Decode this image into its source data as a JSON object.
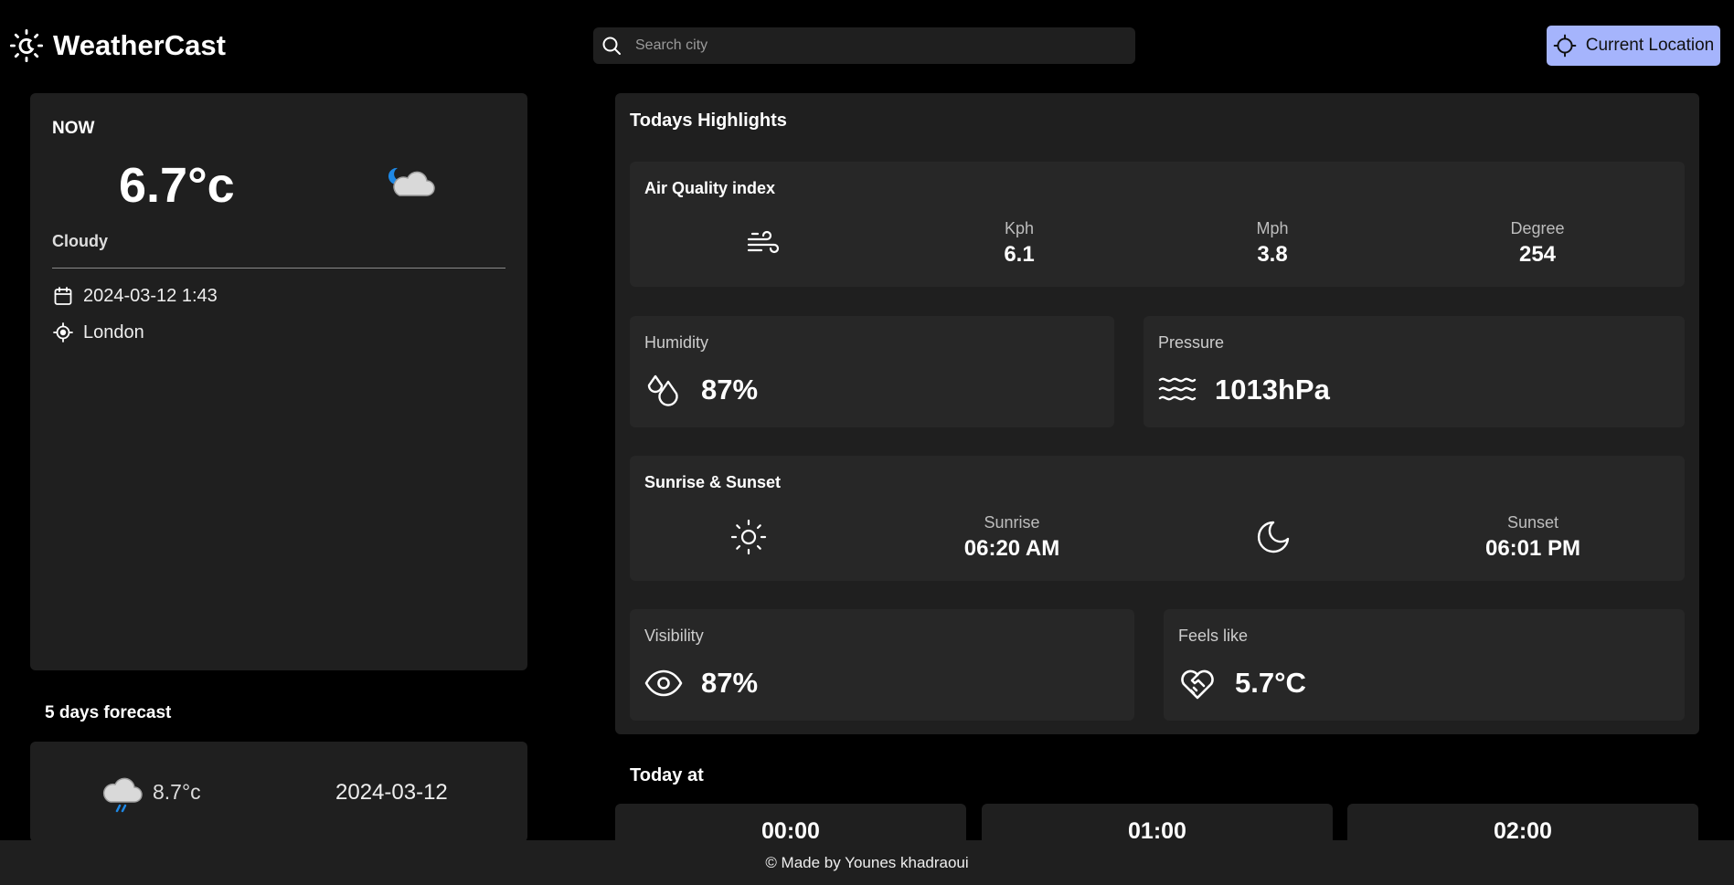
{
  "header": {
    "app_name": "WeatherCast",
    "search": {
      "placeholder": "Search city",
      "value": ""
    },
    "location_button": "Current Location"
  },
  "now": {
    "label": "NOW",
    "temperature": "6.7°c",
    "condition": "Cloudy",
    "datetime": "2024-03-12 1:43",
    "location": "London",
    "icon": "night-cloud-icon"
  },
  "forecast": {
    "title": "5 days forecast",
    "items": [
      {
        "temperature": "8.7°c",
        "date": "2024-03-12",
        "icon": "rain-cloud-icon"
      }
    ]
  },
  "highlights": {
    "title": "Todays Highlights",
    "air_quality": {
      "title": "Air Quality index",
      "kph_label": "Kph",
      "kph": "6.1",
      "mph_label": "Mph",
      "mph": "3.8",
      "degree_label": "Degree",
      "degree": "254"
    },
    "humidity": {
      "label": "Humidity",
      "value": "87%"
    },
    "pressure": {
      "label": "Pressure",
      "value": "1013hPa"
    },
    "sun": {
      "title": "Sunrise & Sunset",
      "sunrise_label": "Sunrise",
      "sunrise": "06:20 AM",
      "sunset_label": "Sunset",
      "sunset": "06:01 PM"
    },
    "visibility": {
      "label": "Visibility",
      "value": "87%"
    },
    "feels_like": {
      "label": "Feels like",
      "value": "5.7°C"
    }
  },
  "today": {
    "title": "Today at",
    "hours": [
      "00:00",
      "01:00",
      "02:00"
    ]
  },
  "footer": "© Made by Younes khadraoui",
  "colors": {
    "accent": "#a5b4fc",
    "card": "#1f1f1f",
    "subcard": "#272727",
    "background": "#000000"
  }
}
